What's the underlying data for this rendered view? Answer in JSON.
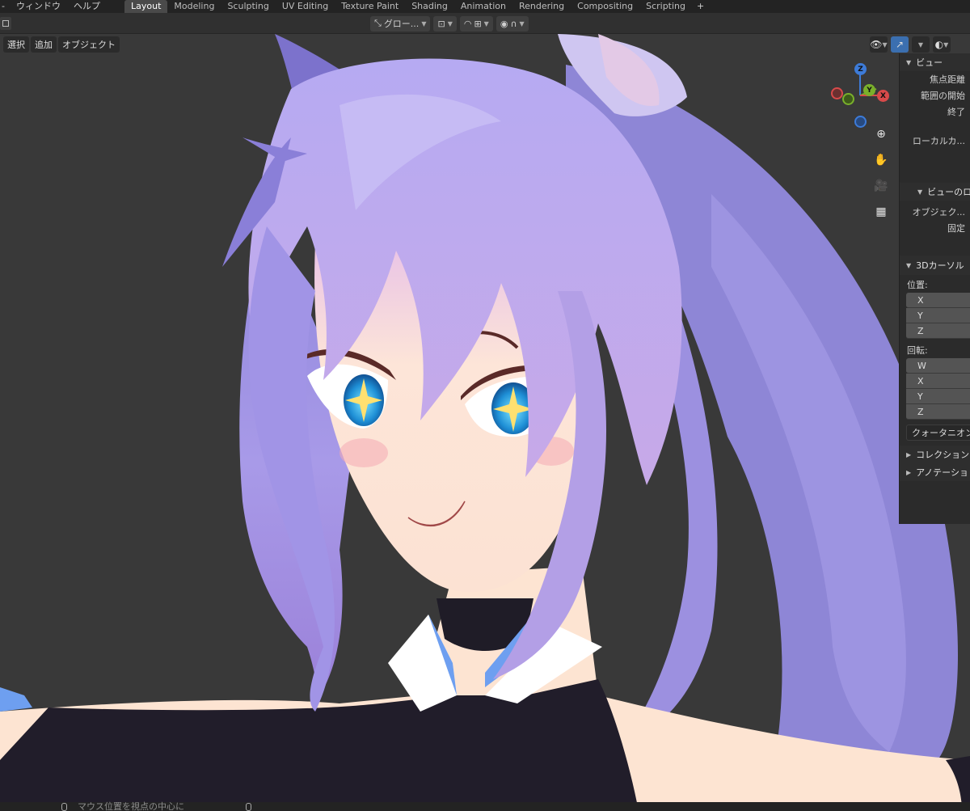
{
  "topbar": {
    "menus": [
      "ウィンドウ",
      "ヘルプ"
    ],
    "tabs": [
      "Layout",
      "Modeling",
      "Sculpting",
      "UV Editing",
      "Texture Paint",
      "Shading",
      "Animation",
      "Rendering",
      "Compositing",
      "Scripting"
    ],
    "active_tab": "Layout",
    "add_tab": "+"
  },
  "header": {
    "orientation_label": "グロー...",
    "orientation_icon": "transform-orientation-icon",
    "pivot_icon": "pivot-point-icon",
    "snap_icon": "snap-icon",
    "snap_target_icon": "snap-increment-icon",
    "proportional_icon": "proportional-edit-icon",
    "falloff_icon": "falloff-curve-icon"
  },
  "viewport": {
    "menus": [
      "選択",
      "追加",
      "オブジェクト"
    ],
    "gizmo_axes": {
      "z": "Z",
      "y": "Y",
      "x": "X"
    },
    "nav_tools": [
      "zoom-icon",
      "hand-pan-icon",
      "camera-icon",
      "grid-icon"
    ]
  },
  "npanel": {
    "view_section": "ビュー",
    "focal_length": "焦点距離",
    "clip_start": "範囲の開始",
    "clip_end": "終了",
    "local_camera": "ローカルカ...",
    "view_lock_section": "ビューのロ",
    "lock_object": "オブジェク...",
    "lock": "固定",
    "cursor_section": "3Dカーソル",
    "location_label": "位置:",
    "location_axes": [
      "X",
      "Y",
      "Z"
    ],
    "rotation_label": "回転:",
    "rotation_axes": [
      "W",
      "X",
      "Y",
      "Z"
    ],
    "rotation_mode": "クォータニオン",
    "collection_section": "コレクション",
    "annotation_section": "アノテーショ"
  },
  "statusbar": {
    "hint": "マウス位置を視点の中心に"
  },
  "colors": {
    "hair_purple": "#9b8ee6",
    "skin": "#fbe0cf",
    "outfit": "#201d2a",
    "collar": "#ffffff",
    "collar_trim": "#6e9ff0",
    "accent_blue": "#3b6fb0"
  }
}
